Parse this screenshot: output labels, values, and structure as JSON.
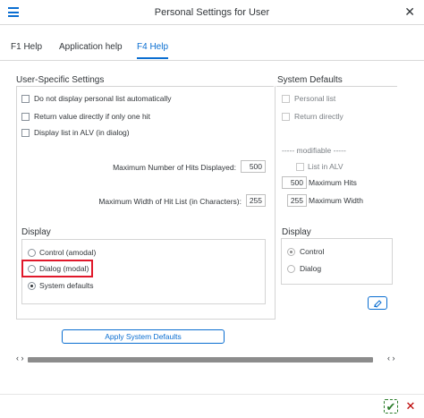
{
  "window": {
    "title": "Personal Settings for User",
    "close_symbol": "✕"
  },
  "tabs": [
    {
      "label": "F1 Help",
      "selected": false
    },
    {
      "label": "Application help",
      "selected": false
    },
    {
      "label": "F4 Help",
      "selected": true
    }
  ],
  "user_settings": {
    "title": "User-Specific Settings",
    "checkboxes": [
      {
        "label": "Do not display personal list automatically",
        "checked": false
      },
      {
        "label": "Return value directly if only one hit",
        "checked": false
      },
      {
        "label": "Display list in ALV (in dialog)",
        "checked": false
      }
    ],
    "max_hits_label": "Maximum Number of Hits Displayed:",
    "max_hits_value": "500",
    "max_width_label": "Maximum Width of Hit List (in Characters):",
    "max_width_value": "255",
    "display": {
      "title": "Display",
      "options": [
        {
          "label": "Control (amodal)",
          "checked": false
        },
        {
          "label": "Dialog (modal)",
          "checked": false
        },
        {
          "label": "System defaults",
          "checked": true
        }
      ]
    }
  },
  "system_defaults": {
    "title": "System Defaults",
    "checkboxes": [
      {
        "label": "Personal list",
        "checked": false
      },
      {
        "label": "Return directly",
        "checked": false
      }
    ],
    "modifiable_label": "----- modifiable -----",
    "list_in_alv_label": "List in ALV",
    "max_hits_value": "500",
    "max_hits_label": "Maximum Hits",
    "max_width_value": "255",
    "max_width_label": "Maximum Width",
    "display": {
      "title": "Display",
      "options": [
        {
          "label": "Control",
          "checked": true
        },
        {
          "label": "Dialog",
          "checked": false
        }
      ]
    }
  },
  "apply_button_label": "Apply System Defaults",
  "scroll": {
    "left_symbol": "‹ ›",
    "right_symbol": "‹ ›"
  },
  "footer": {
    "confirm_symbol": "✔",
    "close_symbol": "✕"
  },
  "colors": {
    "accent": "#0a6ed1",
    "highlight": "#e0182a",
    "confirm": "#2b7d2b",
    "cancel": "#bb0000"
  }
}
